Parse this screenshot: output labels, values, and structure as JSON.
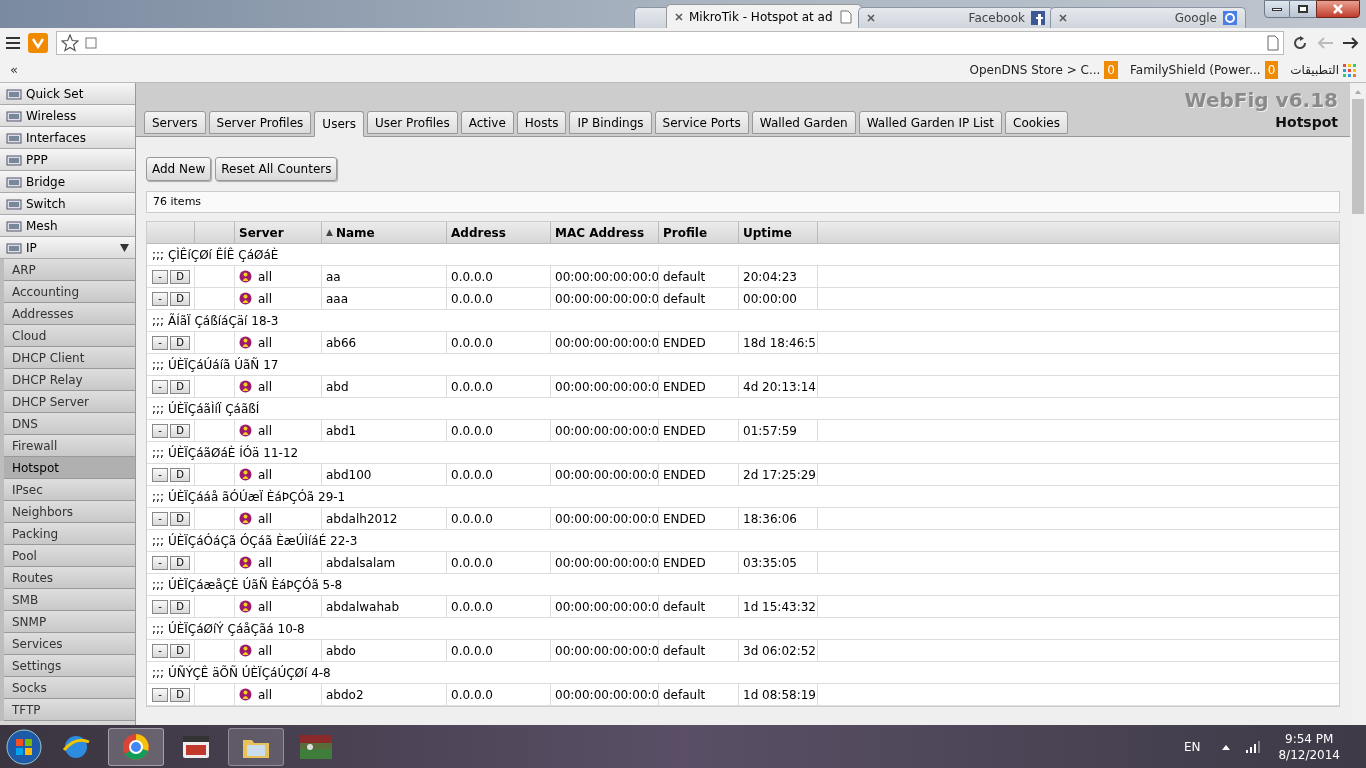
{
  "browser": {
    "tabs": [
      {
        "selected": false
      },
      {
        "title": "MikroTik - Hotspot at ad",
        "selected": true
      },
      {
        "title": "Facebook",
        "selected": false
      },
      {
        "title": "Google",
        "selected": false
      }
    ],
    "bookmarks": [
      {
        "label": "OpenDNS Store > C...",
        "count": "0"
      },
      {
        "label": "FamilyShield (Power...",
        "count": "0"
      }
    ],
    "apps_label": "التطبيقات",
    "chevron": "«"
  },
  "sidebar": {
    "items": [
      {
        "label": "Quick Set",
        "selected": false
      },
      {
        "label": "Wireless",
        "selected": false
      },
      {
        "label": "Interfaces",
        "selected": false
      },
      {
        "label": "PPP",
        "selected": false
      },
      {
        "label": "Bridge",
        "selected": false
      },
      {
        "label": "Switch",
        "selected": false
      },
      {
        "label": "Mesh",
        "selected": false
      },
      {
        "label": "IP",
        "selected": false,
        "expanded": true,
        "children": [
          {
            "label": "ARP",
            "selected": false
          },
          {
            "label": "Accounting",
            "selected": false
          },
          {
            "label": "Addresses",
            "selected": false
          },
          {
            "label": "Cloud",
            "selected": false
          },
          {
            "label": "DHCP Client",
            "selected": false
          },
          {
            "label": "DHCP Relay",
            "selected": false
          },
          {
            "label": "DHCP Server",
            "selected": false
          },
          {
            "label": "DNS",
            "selected": false
          },
          {
            "label": "Firewall",
            "selected": false
          },
          {
            "label": "Hotspot",
            "selected": true
          },
          {
            "label": "IPsec",
            "selected": false
          },
          {
            "label": "Neighbors",
            "selected": false
          },
          {
            "label": "Packing",
            "selected": false
          },
          {
            "label": "Pool",
            "selected": false
          },
          {
            "label": "Routes",
            "selected": false
          },
          {
            "label": "SMB",
            "selected": false
          },
          {
            "label": "SNMP",
            "selected": false
          },
          {
            "label": "Services",
            "selected": false
          },
          {
            "label": "Settings",
            "selected": false
          },
          {
            "label": "Socks",
            "selected": false
          },
          {
            "label": "TFTP",
            "selected": false
          }
        ]
      }
    ]
  },
  "header": {
    "brand": "WebFig v6.18",
    "section": "Hotspot"
  },
  "tabs": [
    {
      "label": "Servers",
      "selected": false
    },
    {
      "label": "Server Profiles",
      "selected": false
    },
    {
      "label": "Users",
      "selected": true
    },
    {
      "label": "User Profiles",
      "selected": false
    },
    {
      "label": "Active",
      "selected": false
    },
    {
      "label": "Hosts",
      "selected": false
    },
    {
      "label": "IP Bindings",
      "selected": false
    },
    {
      "label": "Service Ports",
      "selected": false
    },
    {
      "label": "Walled Garden",
      "selected": false
    },
    {
      "label": "Walled Garden IP List",
      "selected": false
    },
    {
      "label": "Cookies",
      "selected": false
    }
  ],
  "buttons": [
    "Add New",
    "Reset All Counters"
  ],
  "item_count": "76 items",
  "table": {
    "columns": [
      {
        "label": "Server",
        "sorted": false
      },
      {
        "label": "Name",
        "sorted": true,
        "sort_mark": "▲"
      },
      {
        "label": "Address",
        "sorted": false
      },
      {
        "label": "MAC Address",
        "sorted": false
      },
      {
        "label": "Profile",
        "sorted": false
      },
      {
        "label": "Uptime",
        "sorted": false
      }
    ],
    "rows": [
      {
        "kind": "comment",
        "text": ";;; ÇÌÊíÇØí ÊÍÊ ÇáØáÈ"
      },
      {
        "kind": "user",
        "remove": "-",
        "disable": "D",
        "server": "all",
        "name": "aa",
        "address": "0.0.0.0",
        "mac": "00:00:00:00:00:0",
        "profile": "default",
        "uptime": "20:04:23"
      },
      {
        "kind": "user",
        "remove": "-",
        "disable": "D",
        "server": "all",
        "name": "aaa",
        "address": "0.0.0.0",
        "mac": "00:00:00:00:00:0",
        "profile": "default",
        "uptime": "00:00:00"
      },
      {
        "kind": "comment",
        "text": ";;; ÃÍãÏ ÇáßíáÇäí 18-3"
      },
      {
        "kind": "user",
        "remove": "-",
        "disable": "D",
        "server": "all",
        "name": "ab66",
        "address": "0.0.0.0",
        "mac": "00:00:00:00:00:0",
        "profile": "ENDED",
        "uptime": "18d 18:46:5"
      },
      {
        "kind": "comment",
        "text": ";;; ÚÈÏÇáÚáíã ÚãÑ 17"
      },
      {
        "kind": "user",
        "remove": "-",
        "disable": "D",
        "server": "all",
        "name": "abd",
        "address": "0.0.0.0",
        "mac": "00:00:00:00:00:0",
        "profile": "ENDED",
        "uptime": "4d 20:13:14"
      },
      {
        "kind": "comment",
        "text": ";;; ÚÈÏÇáãÌíÏ ÇáãßÍ"
      },
      {
        "kind": "user",
        "remove": "-",
        "disable": "D",
        "server": "all",
        "name": "abd1",
        "address": "0.0.0.0",
        "mac": "00:00:00:00:00:0",
        "profile": "ENDED",
        "uptime": "01:57:59"
      },
      {
        "kind": "comment",
        "text": ";;; ÚÈÏÇáãØáÈ ÍÓä 11-12"
      },
      {
        "kind": "user",
        "remove": "-",
        "disable": "D",
        "server": "all",
        "name": "abd100",
        "address": "0.0.0.0",
        "mac": "00:00:00:00:00:0",
        "profile": "ENDED",
        "uptime": "2d 17:25:29"
      },
      {
        "kind": "comment",
        "text": ";;; ÚÈÏÇááå ãÓÚæÏ ÈáÞÇÓã 29-1"
      },
      {
        "kind": "user",
        "remove": "-",
        "disable": "D",
        "server": "all",
        "name": "abdalh2012",
        "address": "0.0.0.0",
        "mac": "00:00:00:00:00:0",
        "profile": "ENDED",
        "uptime": "18:36:06"
      },
      {
        "kind": "comment",
        "text": ";;; ÚÈÏÇáÓáÇã ÓÇáã ÈæÚÌíáÉ 22-3"
      },
      {
        "kind": "user",
        "remove": "-",
        "disable": "D",
        "server": "all",
        "name": "abdalsalam",
        "address": "0.0.0.0",
        "mac": "00:00:00:00:00:0",
        "profile": "ENDED",
        "uptime": "03:35:05"
      },
      {
        "kind": "comment",
        "text": ";;; ÚÈÏÇáæåÇÈ ÚãÑ ÈáÞÇÓã 5-8"
      },
      {
        "kind": "user",
        "remove": "-",
        "disable": "D",
        "server": "all",
        "name": "abdalwahab",
        "address": "0.0.0.0",
        "mac": "00:00:00:00:00:0",
        "profile": "default",
        "uptime": "1d 15:43:32"
      },
      {
        "kind": "comment",
        "text": ";;; ÚÈÏÇáØíÝ ÇáåÇãá 10-8"
      },
      {
        "kind": "user",
        "remove": "-",
        "disable": "D",
        "server": "all",
        "name": "abdo",
        "address": "0.0.0.0",
        "mac": "00:00:00:00:00:0",
        "profile": "default",
        "uptime": "3d 06:02:52"
      },
      {
        "kind": "comment",
        "text": ";;; ÚÑÝÇÊ äÕÑ ÚÈÏÇáÚÇØí 4-8"
      },
      {
        "kind": "user",
        "remove": "-",
        "disable": "D",
        "server": "all",
        "name": "abdo2",
        "address": "0.0.0.0",
        "mac": "00:00:00:00:00:0",
        "profile": "default",
        "uptime": "1d 08:58:19"
      }
    ]
  },
  "taskbar": {
    "language": "EN",
    "time": "9:54 PM",
    "date": "8/12/2014"
  }
}
